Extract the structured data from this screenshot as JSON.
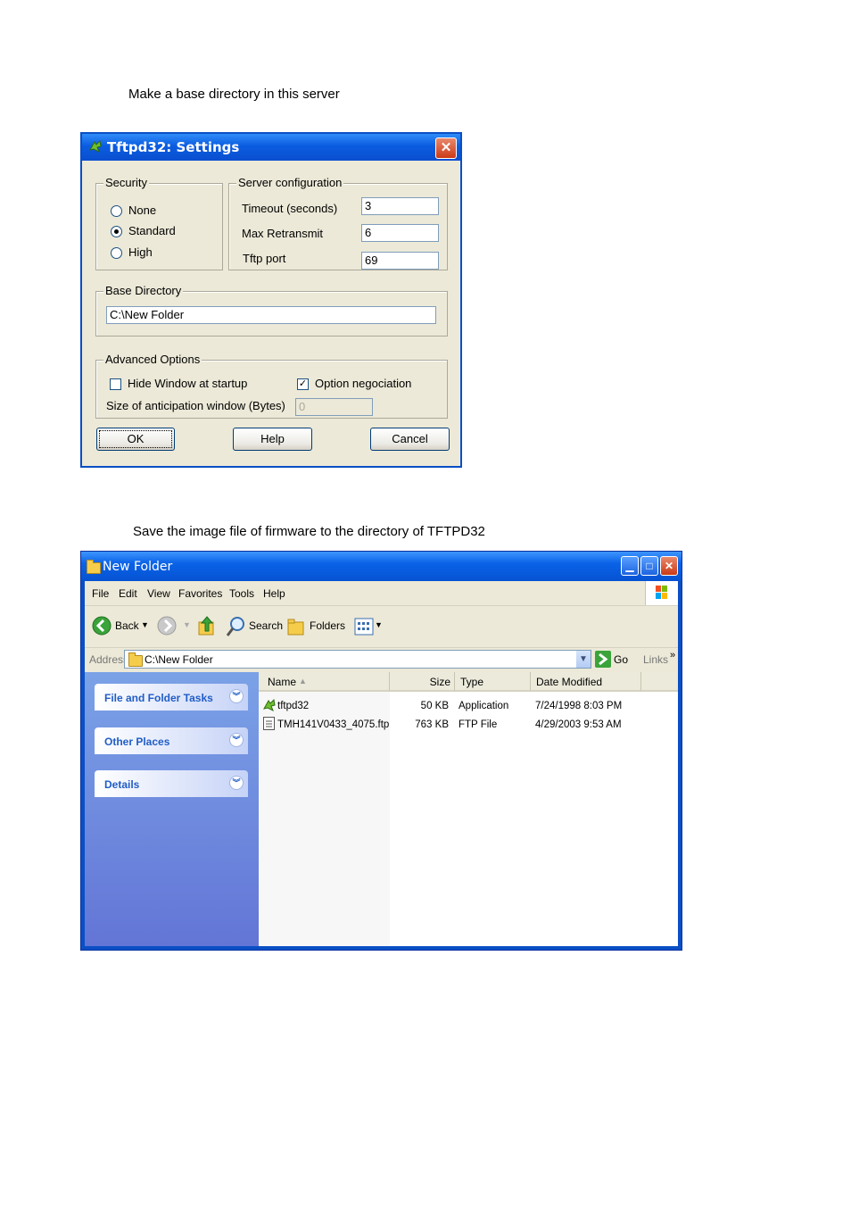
{
  "captions": {
    "first": "Make a base directory in this server",
    "second": "Save the image file of firmware to the directory of TFTPD32"
  },
  "settings_dialog": {
    "title": "Tftpd32: Settings",
    "security": {
      "legend": "Security",
      "options": [
        "None",
        "Standard",
        "High"
      ],
      "selected": "Standard"
    },
    "server_config": {
      "legend": "Server configuration",
      "timeout_label": "Timeout (seconds)",
      "timeout_value": "3",
      "retransmit_label": "Max Retransmit",
      "retransmit_value": "6",
      "port_label": "Tftp port",
      "port_value": "69"
    },
    "base_directory": {
      "legend": "Base Directory",
      "value": "C:\\New Folder"
    },
    "advanced": {
      "legend": "Advanced Options",
      "hide_window_label": "Hide Window at startup",
      "hide_window_checked": false,
      "option_negociation_label": "Option negociation",
      "option_negociation_checked": true,
      "anticipation_label": "Size of anticipation window (Bytes)",
      "anticipation_value": "0"
    },
    "buttons": {
      "ok": "OK",
      "help": "Help",
      "cancel": "Cancel"
    }
  },
  "explorer": {
    "title": "New Folder",
    "menu": [
      "File",
      "Edit",
      "View",
      "Favorites",
      "Tools",
      "Help"
    ],
    "toolbar": {
      "back": "Back",
      "search": "Search",
      "folders": "Folders"
    },
    "address": {
      "label": "Address",
      "value": "C:\\New Folder",
      "go": "Go",
      "links": "Links"
    },
    "task_panes": [
      "File and Folder Tasks",
      "Other Places",
      "Details"
    ],
    "columns": {
      "name": "Name",
      "size": "Size",
      "type": "Type",
      "date": "Date Modified"
    },
    "files": [
      {
        "name": "tftpd32",
        "size": "50 KB",
        "type": "Application",
        "date": "7/24/1998 8:03 PM",
        "icon": "tftpd32-app-icon"
      },
      {
        "name": "TMH141V0433_4075.ftp",
        "size": "763 KB",
        "type": "FTP File",
        "date": "4/29/2003 9:53 AM",
        "icon": "ftp-file-icon"
      }
    ]
  }
}
